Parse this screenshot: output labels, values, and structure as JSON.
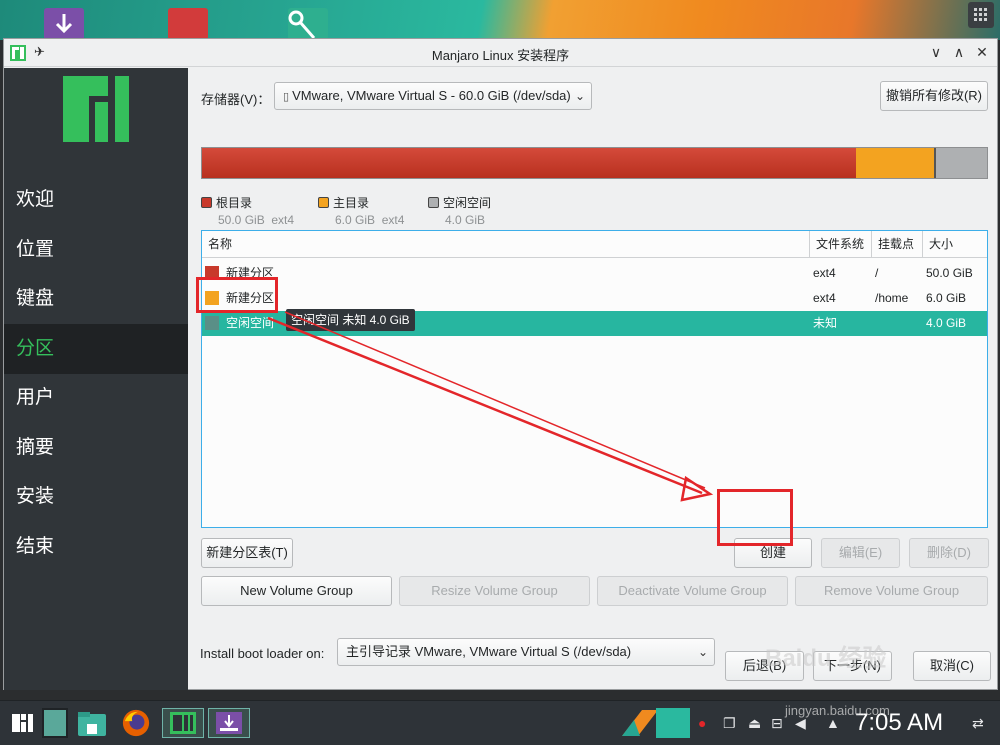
{
  "window": {
    "title": "Manjaro Linux 安装程序",
    "pin_glyph": "✈",
    "min_glyph": "∨",
    "max_glyph": "∧",
    "close_glyph": "✕"
  },
  "sidebar": {
    "items": [
      {
        "label": "欢迎"
      },
      {
        "label": "位置"
      },
      {
        "label": "键盘"
      },
      {
        "label": "分区"
      },
      {
        "label": "用户"
      },
      {
        "label": "摘要"
      },
      {
        "label": "安装"
      },
      {
        "label": "结束"
      }
    ],
    "active_index": 3
  },
  "storage": {
    "label": "存储器(V)：",
    "device": "VMware, VMware Virtual S - 60.0 GiB (/dev/sda)",
    "revert_label": "撤销所有修改(R)"
  },
  "usage_bar": {
    "segments": [
      {
        "name": "根目录",
        "size": "50.0 GiB",
        "fs": "ext4",
        "color": "#c8392b",
        "fraction": 0.8333
      },
      {
        "name": "主目录",
        "size": "6.0 GiB",
        "fs": "ext4",
        "color": "#f3a320",
        "fraction": 0.1
      },
      {
        "name": "空闲空间",
        "size": "4.0 GiB",
        "fs": "",
        "color": "#aeb0b2",
        "fraction": 0.0667
      }
    ]
  },
  "table": {
    "headers": [
      "名称",
      "文件系统",
      "挂载点",
      "大小"
    ],
    "rows": [
      {
        "name": "新建分区",
        "fs": "ext4",
        "mount": "/",
        "size": "50.0 GiB",
        "color": "#c8392b"
      },
      {
        "name": "新建分区",
        "fs": "ext4",
        "mount": "/home",
        "size": "6.0 GiB",
        "color": "#f3a320"
      },
      {
        "name": "空闲空间",
        "fs": "未知",
        "mount": "",
        "size": "4.0 GiB",
        "color": "#5a8f87"
      }
    ],
    "selected_index": 2,
    "tooltip": "空闲空间 未知 4.0 GiB"
  },
  "actions": {
    "new_table": "新建分区表(T)",
    "create": "创建",
    "edit": "编辑(E)",
    "delete": "删除(D)",
    "new_vg": "New Volume Group",
    "resize_vg": "Resize Volume Group",
    "deactivate_vg": "Deactivate Volume Group",
    "remove_vg": "Remove Volume Group"
  },
  "bootloader": {
    "label": "Install boot loader on:",
    "value": "主引导记录 VMware, VMware Virtual S (/dev/sda)"
  },
  "footer": {
    "back": "后退(B)",
    "next": "下一步(N)",
    "cancel": "取消(C)"
  },
  "taskbar": {
    "clock": "7:05 AM"
  },
  "watermark": {
    "text": "Baidu 经验",
    "url": "jingyan.baidu.com"
  }
}
